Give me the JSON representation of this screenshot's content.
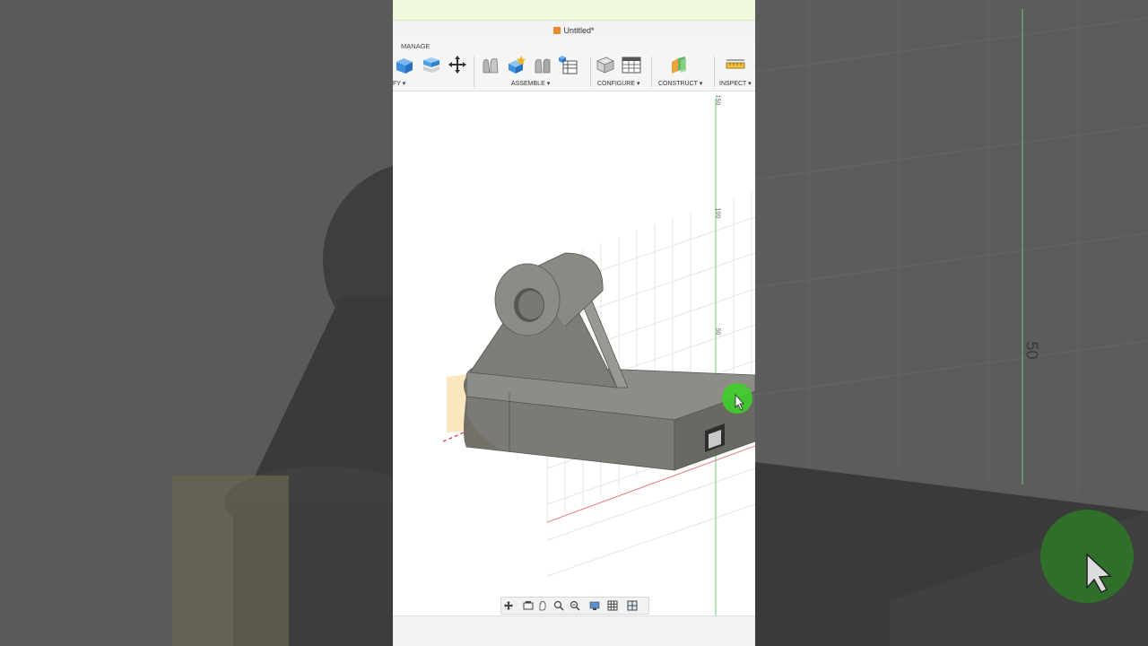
{
  "window": {
    "title": "Untitled*"
  },
  "toolbar": {
    "manage_tab": "MANAGE",
    "modify_label_partial": "FY",
    "groups": [
      {
        "label": "ASSEMBLE"
      },
      {
        "label": "CONFIGURE"
      },
      {
        "label": "CONSTRUCT"
      },
      {
        "label": "INSPECT"
      }
    ]
  },
  "viewport": {
    "ruler_ticks": [
      "150",
      "100",
      "50"
    ],
    "background_ruler": "50"
  },
  "colors": {
    "accent_orange": "#e8892b",
    "cursor_highlight": "#3ecf2a",
    "model_gray": "#7c7a74",
    "axis_green": "#6fd36f",
    "axis_red": "#e05a5a"
  },
  "icons": [
    "cube-orange-icon",
    "box-blue-icon",
    "box-stack-icon",
    "move-icon",
    "joint-icon",
    "as-built-joint-icon",
    "motion-link-icon",
    "table-icon",
    "configure-icon",
    "configure-table-icon",
    "construct-plane-icon",
    "measure-icon",
    "orbit-icon",
    "look-at-icon",
    "pan-icon",
    "zoom-icon",
    "fit-icon",
    "display-icon",
    "grid-icon",
    "viewports-icon",
    "cursor-arrow-icon"
  ]
}
